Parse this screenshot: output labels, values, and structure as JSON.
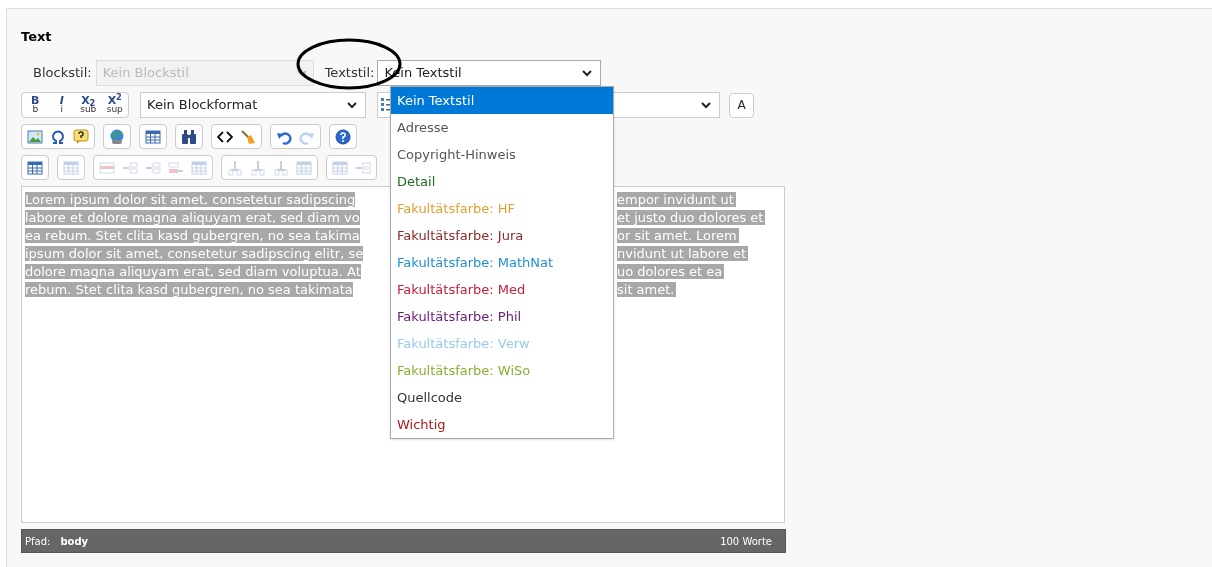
{
  "section_title": "Text",
  "blockstil": {
    "label": "Blockstil:",
    "value": "Kein Blockstil",
    "disabled": true
  },
  "textstil": {
    "label": "Textstil:",
    "value": "Kein Textstil",
    "expanded": true,
    "options": [
      {
        "label": "Kein Textstil",
        "selected": true
      },
      {
        "label": "Adresse",
        "selected": false,
        "color": "#555555"
      },
      {
        "label": "Copyright-Hinweis",
        "selected": false,
        "color": "#555555"
      },
      {
        "label": "Detail",
        "selected": false,
        "color": "#1e6b1e"
      },
      {
        "label": "Fakultätsfarbe: HF",
        "selected": false,
        "color": "#e0a030"
      },
      {
        "label": "Fakultätsfarbe: Jura",
        "selected": false,
        "color": "#8b2a2a"
      },
      {
        "label": "Fakultätsfarbe: MathNat",
        "selected": false,
        "color": "#1e8fd0"
      },
      {
        "label": "Fakultätsfarbe: Med",
        "selected": false,
        "color": "#c0203a"
      },
      {
        "label": "Fakultätsfarbe: Phil",
        "selected": false,
        "color": "#6a1a7a"
      },
      {
        "label": "Fakultätsfarbe: Verw",
        "selected": false,
        "color": "#99c8ee"
      },
      {
        "label": "Fakultätsfarbe: WiSo",
        "selected": false,
        "color": "#8ab030"
      },
      {
        "label": "Quellcode",
        "selected": false,
        "color": "#333333"
      },
      {
        "label": "Wichtig",
        "selected": false,
        "color": "#b01a1a"
      }
    ]
  },
  "format_buttons": [
    {
      "label": "B",
      "caption": "b"
    },
    {
      "label": "I",
      "caption": "i"
    },
    {
      "label": "X$_{2}$",
      "caption": "sub"
    },
    {
      "label": "X$^{2}$",
      "caption": "sup"
    }
  ],
  "blockformat": "Kein Blockformat",
  "a_button": "A",
  "toolbar_rows": [
    [
      [
        {
          "kind": "image",
          "disabled": false
        },
        {
          "kind": "omega",
          "disabled": false
        },
        {
          "kind": "bubble",
          "disabled": false
        }
      ],
      [
        {
          "kind": "globe",
          "disabled": false
        }
      ],
      [
        {
          "kind": "table",
          "disabled": false
        }
      ],
      [
        {
          "kind": "binoculars",
          "disabled": false
        }
      ],
      [
        {
          "kind": "code",
          "disabled": false
        },
        {
          "kind": "broom",
          "disabled": false
        }
      ],
      [
        {
          "kind": "undo",
          "disabled": false
        },
        {
          "kind": "redo",
          "disabled": true
        }
      ],
      [
        {
          "kind": "help",
          "disabled": false
        }
      ]
    ],
    [
      [
        {
          "kind": "table",
          "disabled": false
        }
      ],
      [
        {
          "kind": "table",
          "disabled": true
        }
      ],
      [
        {
          "kind": "row",
          "disabled": true
        },
        {
          "kind": "rowinsert",
          "disabled": true
        },
        {
          "kind": "rowinsert",
          "disabled": true
        },
        {
          "kind": "rowmove",
          "disabled": true
        },
        {
          "kind": "table",
          "disabled": true
        }
      ],
      [
        {
          "kind": "col",
          "disabled": true
        },
        {
          "kind": "col",
          "disabled": true
        },
        {
          "kind": "col",
          "disabled": true
        },
        {
          "kind": "table",
          "disabled": true
        }
      ],
      [
        {
          "kind": "table",
          "disabled": true
        },
        {
          "kind": "rowinsert",
          "disabled": true
        }
      ]
    ]
  ],
  "editor_lines": [
    {
      "left": "Lorem ipsum dolor sit amet, consetetur sadipscing",
      "right": "empor invidunt ut"
    },
    {
      "left": "labore et dolore magna aliquyam erat, sed diam vo",
      "right": "et justo duo dolores et"
    },
    {
      "left": "ea rebum. Stet clita kasd gubergren, no sea takima",
      "right": "or sit amet. Lorem"
    },
    {
      "left": "ipsum dolor sit amet, consetetur sadipscing elitr, se",
      "right": "nvidunt ut labore et"
    },
    {
      "left": "dolore magna aliquyam erat, sed diam voluptua. At",
      "right": "uo dolores et ea"
    },
    {
      "left": "rebum. Stet clita kasd gubergren, no sea takimata",
      "right": "sit amet."
    }
  ],
  "status_bar": {
    "path_label": "Pfad:",
    "path": "body",
    "word_count": "100 Worte"
  }
}
